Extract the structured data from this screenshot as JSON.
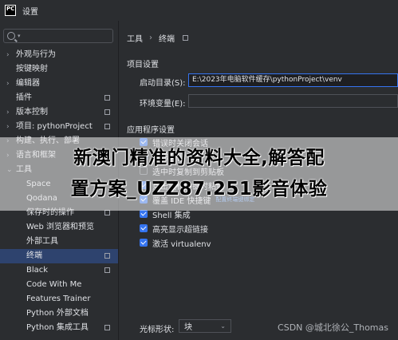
{
  "window": {
    "title": "设置",
    "app_icon_text": "PC"
  },
  "sidebar": {
    "items": [
      {
        "label": "外观与行为",
        "arrow": "›",
        "level": 0
      },
      {
        "label": "按键映射",
        "arrow": "",
        "level": 0
      },
      {
        "label": "编辑器",
        "arrow": "›",
        "level": 0
      },
      {
        "label": "插件",
        "arrow": "",
        "level": 0,
        "gear": true
      },
      {
        "label": "版本控制",
        "arrow": "›",
        "level": 0,
        "gear": true
      },
      {
        "label": "项目: pythonProject",
        "arrow": "›",
        "level": 0,
        "gear": true
      },
      {
        "label": "构建、执行、部署",
        "arrow": "›",
        "level": 0
      },
      {
        "label": "语言和框架",
        "arrow": "›",
        "level": 0
      },
      {
        "label": "工具",
        "arrow": "⌄",
        "level": 0
      },
      {
        "label": "Space",
        "arrow": "",
        "level": 1
      },
      {
        "label": "Qodana",
        "arrow": "",
        "level": 1
      },
      {
        "label": "保存时的操作",
        "arrow": "",
        "level": 1,
        "gear": true
      },
      {
        "label": "Web 浏览器和预览",
        "arrow": "",
        "level": 1
      },
      {
        "label": "外部工具",
        "arrow": "",
        "level": 1
      },
      {
        "label": "终端",
        "arrow": "",
        "level": 1,
        "gear": true,
        "selected": true
      },
      {
        "label": "Black",
        "arrow": "",
        "level": 1,
        "gear": true
      },
      {
        "label": "Code With Me",
        "arrow": "",
        "level": 1
      },
      {
        "label": "Features Trainer",
        "arrow": "",
        "level": 1
      },
      {
        "label": "Python 外部文档",
        "arrow": "",
        "level": 1
      },
      {
        "label": "Python 集成工具",
        "arrow": "",
        "level": 1,
        "gear": true
      }
    ]
  },
  "breadcrumb": {
    "parent": "工具",
    "separator": "›",
    "current": "终端"
  },
  "project_settings": {
    "heading": "项目设置",
    "start_dir_label": "启动目录(S):",
    "start_dir_value": "E:\\2023年电脑软件缓存\\pythonProject\\venv",
    "env_label": "环境变量(E):",
    "env_value": ""
  },
  "app_settings": {
    "heading": "应用程序设置",
    "checkboxes": [
      {
        "label": "错误时关闭会话",
        "checked": true
      },
      {
        "label": "鼠标报告",
        "checked": true
      },
      {
        "label": "选中时复制到剪贴板",
        "checked": false
      },
      {
        "label": "点击鼠标中键时粘贴",
        "checked": true
      },
      {
        "label": "覆盖 IDE 快捷键",
        "checked": true,
        "link": "配置终端键绑定"
      },
      {
        "label": "Shell 集成",
        "checked": true
      },
      {
        "label": "高亮显示超链接",
        "checked": true
      },
      {
        "label": "激活 virtualenv",
        "checked": true
      }
    ],
    "cursor_label": "光标形状:",
    "cursor_value": "块"
  },
  "overlay": {
    "line1": "新澳门精准的资料大全,解答配",
    "line2": "置方案_UZZ87.251影音体验"
  },
  "watermark": "CSDN @城北徐公_Thomas"
}
